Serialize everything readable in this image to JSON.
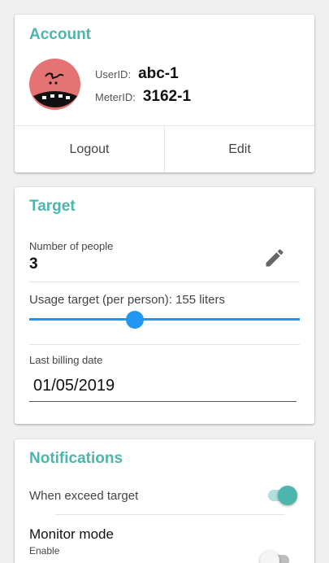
{
  "account": {
    "title": "Account",
    "user_id_label": "UserID:",
    "user_id": "abc-1",
    "meter_id_label": "MeterID:",
    "meter_id": "3162-1",
    "logout_label": "Logout",
    "edit_label": "Edit",
    "avatar_icon": "cartoon-face-avatar",
    "avatar_color": "#e57373"
  },
  "target": {
    "title": "Target",
    "people_label": "Number of people",
    "people_value": "3",
    "edit_icon": "pencil-icon",
    "usage_label": "Usage target (per person): 155 liters",
    "usage_slider_fraction": 0.39,
    "billing_label": "Last billing date",
    "billing_date": "01/05/2019"
  },
  "notifications": {
    "title": "Notifications",
    "exceed_label": "When exceed target",
    "exceed_enabled": true,
    "monitor_label": "Monitor mode",
    "monitor_sub": "Enable",
    "monitor_enabled": false
  },
  "colors": {
    "accent": "#4db6ac",
    "slider": "#2196f3",
    "background": "#f0f0f0"
  }
}
